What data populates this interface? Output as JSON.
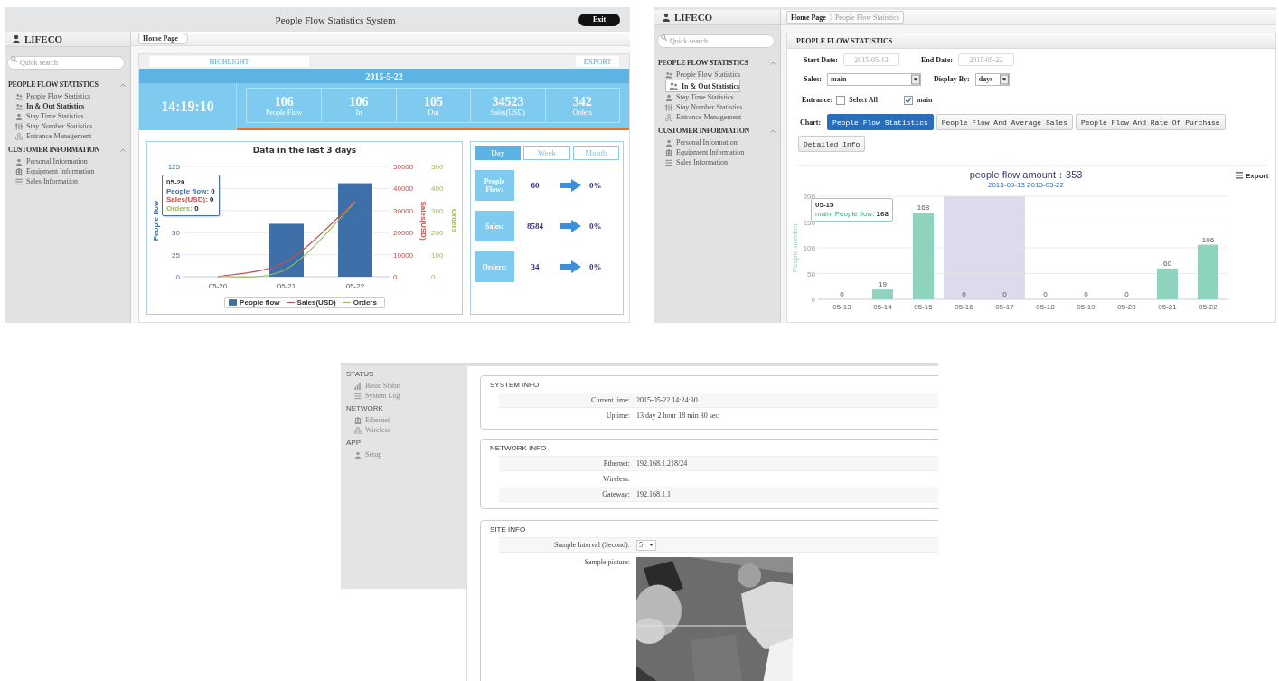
{
  "dashboard": {
    "header": {
      "title": "People Flow Statistics System",
      "exit": "Exit"
    },
    "sidebar": {
      "brand": "LIFECO",
      "search_placeholder": "Quick search",
      "sections": [
        {
          "title": "PEOPLE FLOW STATISTICS",
          "expanded": true,
          "items": [
            {
              "label": "People Flow Statistics",
              "selected": false
            },
            {
              "label": "In & Out Statistics",
              "selected": true
            },
            {
              "label": "Stay Time Statistics",
              "selected": false
            },
            {
              "label": "Stay Number Statistics",
              "selected": false
            },
            {
              "label": "Entrance Management",
              "selected": false
            }
          ]
        },
        {
          "title": "CUSTOMER INFORMATION",
          "expanded": true,
          "items": [
            {
              "label": "Personal Information",
              "selected": false
            },
            {
              "label": "Equipment Information",
              "selected": false
            },
            {
              "label": "Sales Information",
              "selected": false
            }
          ]
        }
      ]
    },
    "breadcrumb": [
      "Home Page"
    ],
    "highlight": {
      "tab": "HIGHLIGHT",
      "export": "EXPORT",
      "date": "2015-5-22",
      "time": "14:19:10",
      "metrics": [
        {
          "value": "106",
          "label": "People Flow"
        },
        {
          "value": "106",
          "label": "In"
        },
        {
          "value": "105",
          "label": "Out"
        },
        {
          "value": "34523",
          "label": "Sales(USD)"
        },
        {
          "value": "342",
          "label": "Orders"
        }
      ]
    },
    "trend_chart": {
      "chart_data": {
        "type": "bar",
        "title": "Data in the last 3 days",
        "ylabel": "People flow",
        "y2label": "Sales(USD)",
        "y3label": "Orders",
        "categories": [
          "05-20",
          "05-21",
          "05-22"
        ],
        "series": [
          {
            "name": "People flow",
            "color": "#3e6fa8",
            "axis": "y",
            "values": [
              0,
              60,
              106
            ]
          },
          {
            "name": "Sales(USD)",
            "color": "#c0504d",
            "type": "line",
            "axis": "y2",
            "values": [
              0,
              7000,
              34500
            ]
          },
          {
            "name": "Orders",
            "color": "#9bbb59",
            "type": "line",
            "axis": "y3",
            "values": [
              0,
              35,
              340
            ]
          }
        ],
        "ylim": [
          0,
          125
        ],
        "yticks": [
          0,
          25,
          50,
          125
        ],
        "grid": true,
        "legend": "bottom",
        "y2lim": [
          0,
          50000
        ],
        "y2ticks": [
          0,
          10000,
          20000,
          30000,
          40000,
          50000
        ],
        "y3lim": [
          0,
          500
        ],
        "y3ticks": [
          0,
          100,
          200,
          300,
          400,
          500
        ]
      },
      "tooltip": {
        "title": "05-20",
        "lines": [
          {
            "label": "People flow:",
            "value": "0"
          },
          {
            "label": "Sales(USD):",
            "value": "0"
          },
          {
            "label": "Orders:",
            "value": "0"
          }
        ]
      }
    },
    "comparison": {
      "tabs": [
        {
          "label": "Day",
          "selected": true
        },
        {
          "label": "Week",
          "selected": false
        },
        {
          "label": "Month",
          "selected": false
        }
      ],
      "rows": [
        {
          "label": "People Flow:",
          "value": "60",
          "change": "0%"
        },
        {
          "label": "Sales:",
          "value": "8584",
          "change": "0%"
        },
        {
          "label": "Orders:",
          "value": "34",
          "change": "0%"
        }
      ]
    }
  },
  "statistics": {
    "sidebar": {
      "brand": "LIFECO",
      "search_placeholder": "Quick search",
      "sections": [
        {
          "title": "PEOPLE FLOW STATISTICS",
          "expanded": true,
          "items": [
            {
              "label": "People Flow Statistics",
              "selected": false
            },
            {
              "label": "In & Out Statistics",
              "selected": true
            },
            {
              "label": "Stay Time Statistics",
              "selected": false
            },
            {
              "label": "Stay Number Statistics",
              "selected": false
            },
            {
              "label": "Entrance Management",
              "selected": false
            }
          ]
        },
        {
          "title": "CUSTOMER INFORMATION",
          "expanded": true,
          "items": [
            {
              "label": "Personal Information",
              "selected": false
            },
            {
              "label": "Equipment Information",
              "selected": false
            },
            {
              "label": "Sales Information",
              "selected": false
            }
          ]
        }
      ]
    },
    "breadcrumb": [
      "Home Page",
      "People Flow Statistics"
    ],
    "panel_title": "PEOPLE FLOW STATISTICS",
    "form": {
      "start_date": {
        "label": "Start Date:",
        "placeholder": "2015-05-13"
      },
      "end_date": {
        "label": "End Date:",
        "placeholder": "2015-05-22"
      },
      "sales": {
        "label": "Sales:",
        "value": "main"
      },
      "display_by": {
        "label": "Display By:",
        "value": "days"
      },
      "entrance": {
        "label": "Entrance:",
        "options": [
          {
            "label": "Select All",
            "checked": false
          },
          {
            "label": "main",
            "checked": true
          }
        ]
      },
      "chart": {
        "label": "Chart:",
        "buttons": [
          {
            "label": "People Flow Statistics",
            "selected": true
          },
          {
            "label": "People Flow And Average Sales",
            "selected": false
          },
          {
            "label": "People Flow And Rate Of Purchase",
            "selected": false
          }
        ]
      },
      "detail_button": "Detailed Info"
    },
    "flow_chart": {
      "export": "Export",
      "chart_data": {
        "type": "bar",
        "title": "people flow amount：353",
        "subtitle": "2015-05-13 2015-05-22",
        "ylabel": "People number",
        "categories": [
          "05-13",
          "05-14",
          "05-15",
          "05-16",
          "05-17",
          "05-18",
          "05-19",
          "05-20",
          "05-21",
          "05-22"
        ],
        "values": [
          0,
          19,
          168,
          0,
          0,
          0,
          0,
          0,
          60,
          106
        ],
        "ylim": [
          0,
          200
        ],
        "yticks": [
          0,
          50,
          100,
          150,
          200
        ],
        "grid": true,
        "data_labels": true
      },
      "column_highlighted": [
        false,
        false,
        false,
        true,
        true,
        false,
        false,
        false,
        false,
        false
      ],
      "tooltip": {
        "title": "05-15",
        "line": "main: People flow:",
        "value": "168"
      }
    }
  },
  "router": {
    "sidebar": [
      {
        "title": "STATUS",
        "items": [
          {
            "label": "Basic Status"
          },
          {
            "label": "System Log"
          }
        ]
      },
      {
        "title": "NETWORK",
        "items": [
          {
            "label": "Ethernet"
          },
          {
            "label": "Wireless"
          }
        ]
      },
      {
        "title": "APP",
        "items": [
          {
            "label": "Setup"
          }
        ]
      }
    ],
    "sections": [
      {
        "title": "SYSTEM INFO",
        "rows": [
          {
            "kind": "text",
            "label": "Current time:",
            "value": "2015-05-22 14:24:30"
          },
          {
            "kind": "text",
            "label": "Uptime:",
            "value": "13 day 2 hour 18 min 30 sec"
          }
        ]
      },
      {
        "title": "NETWORK INFO",
        "rows": [
          {
            "kind": "text",
            "label": "Ethernet:",
            "value": "192.168.1.218/24"
          },
          {
            "kind": "text",
            "label": "Wireless:"
          },
          {
            "kind": "text",
            "label": "Gateway:",
            "value": "192.168.1.1"
          }
        ]
      },
      {
        "title": "SITE INFO",
        "rows": [
          {
            "kind": "select",
            "label": "Sample Interval (Second):",
            "value": "5"
          },
          {
            "kind": "picture",
            "label": "Sample picture:"
          }
        ]
      }
    ]
  }
}
